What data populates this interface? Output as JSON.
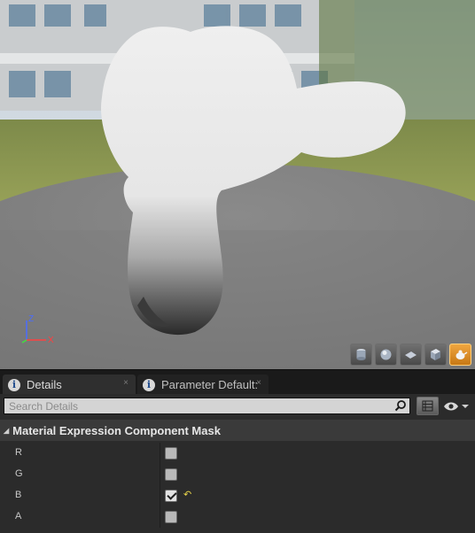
{
  "viewport": {
    "axis_labels": {
      "z": "Z",
      "x": "X"
    },
    "preview_buttons": [
      {
        "icon": "cylinder-icon"
      },
      {
        "icon": "sphere-icon"
      },
      {
        "icon": "plane-icon"
      },
      {
        "icon": "cube-icon"
      },
      {
        "icon": "teapot-mesh-icon",
        "active": true
      }
    ]
  },
  "tabs": [
    {
      "label": "Details",
      "icon": "info-icon",
      "close": "×"
    },
    {
      "label": "Parameter Default:",
      "icon": "info-icon",
      "close": "×"
    }
  ],
  "search": {
    "placeholder": "Search Details"
  },
  "category": {
    "title": "Material Expression Component Mask",
    "arrow": "◢"
  },
  "properties": [
    {
      "name": "R",
      "checked": false
    },
    {
      "name": "G",
      "checked": false
    },
    {
      "name": "B",
      "checked": true,
      "reset": "↶"
    },
    {
      "name": "A",
      "checked": false
    }
  ],
  "colors": {
    "accent_active": "#f0a640",
    "reset_arrow": "#e8d44a",
    "axis_z": "#4a6cff",
    "axis_x": "#ff4040",
    "axis_y": "#40e040"
  }
}
